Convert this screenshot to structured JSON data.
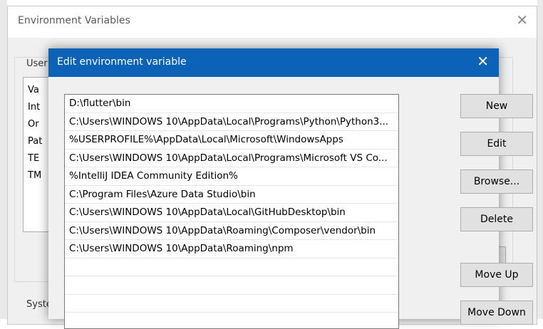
{
  "outer_window": {
    "title": "Environment Variables",
    "user_group_label": "User",
    "system_group_label": "Syste",
    "user_variables_partial": [
      "Va",
      "Int",
      "Or",
      "Pat",
      "TE",
      "TM"
    ]
  },
  "dialog": {
    "title": "Edit environment variable",
    "entries": [
      "D:\\flutter\\bin",
      "C:\\Users\\WINDOWS 10\\AppData\\Local\\Programs\\Python\\Python3...",
      "%USERPROFILE%\\AppData\\Local\\Microsoft\\WindowsApps",
      "C:\\Users\\WINDOWS 10\\AppData\\Local\\Programs\\Microsoft VS Co...",
      "%IntelliJ IDEA Community Edition%",
      "C:\\Program Files\\Azure Data Studio\\bin",
      "C:\\Users\\WINDOWS 10\\AppData\\Local\\GitHubDesktop\\bin",
      "C:\\Users\\WINDOWS 10\\AppData\\Roaming\\Composer\\vendor\\bin",
      "C:\\Users\\WINDOWS 10\\AppData\\Roaming\\npm"
    ],
    "buttons": {
      "new": "New",
      "edit": "Edit",
      "browse": "Browse...",
      "delete": "Delete",
      "move_up": "Move Up",
      "move_down": "Move Down"
    }
  },
  "icons": {
    "close": "close-icon"
  },
  "colors": {
    "dialog_titlebar": "#0b62b7",
    "window_bg": "#f0f0f0"
  }
}
